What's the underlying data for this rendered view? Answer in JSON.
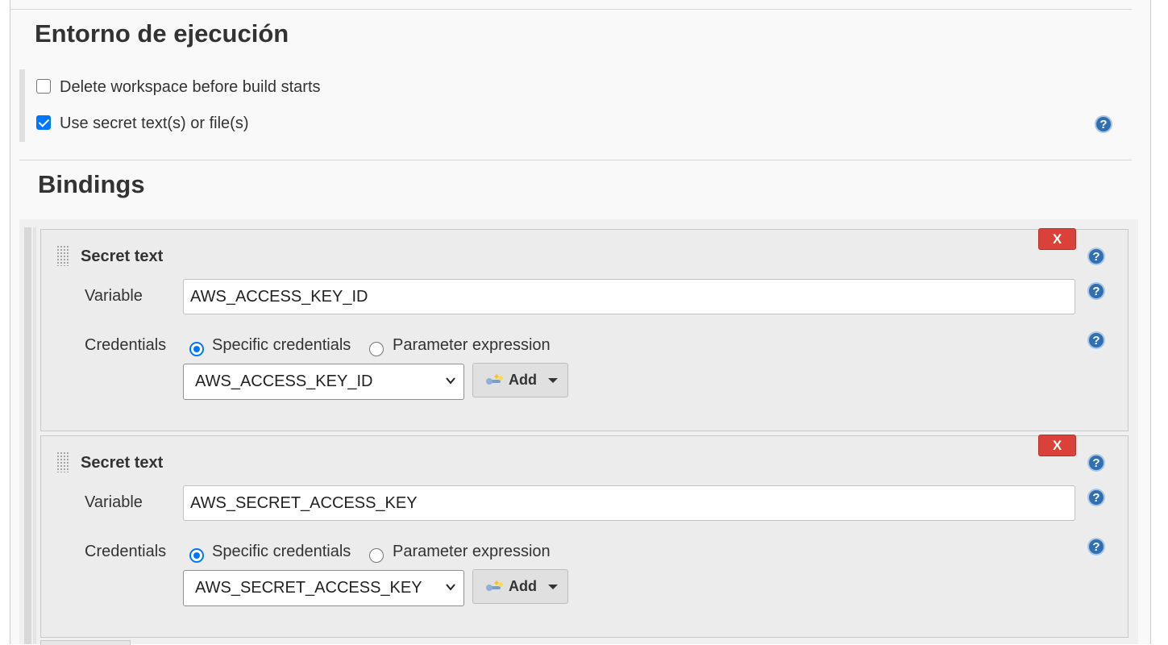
{
  "runtime": {
    "title": "Entorno de ejecución",
    "delete_workspace": {
      "label": "Delete workspace before build starts",
      "checked": false
    },
    "use_secret": {
      "label": "Use secret text(s) or file(s)",
      "checked": true
    },
    "help_glyph": "?"
  },
  "bindings": {
    "title": "Bindings",
    "items": [
      {
        "title": "Secret text",
        "delete_label": "X",
        "variable_label": "Variable",
        "variable_value": "AWS_ACCESS_KEY_ID",
        "credentials_label": "Credentials",
        "radio_specific": "Specific credentials",
        "radio_parameter": "Parameter expression",
        "selected_credential": "AWS_ACCESS_KEY_ID",
        "add_label": "Add"
      },
      {
        "title": "Secret text",
        "delete_label": "X",
        "variable_label": "Variable",
        "variable_value": "AWS_SECRET_ACCESS_KEY",
        "credentials_label": "Credentials",
        "radio_specific": "Specific credentials",
        "radio_parameter": "Parameter expression",
        "selected_credential": "AWS_SECRET_ACCESS_KEY",
        "add_label": "Add"
      }
    ]
  },
  "icons": {
    "help": "help-icon",
    "grip": "drag-handle-icon",
    "key": "key-icon",
    "chevron": "chevron-down-icon",
    "caret": "caret-down-icon"
  },
  "colors": {
    "accent": "#0075ff",
    "delete_button": "#d9413a",
    "help_icon": "#2f6fb2"
  }
}
